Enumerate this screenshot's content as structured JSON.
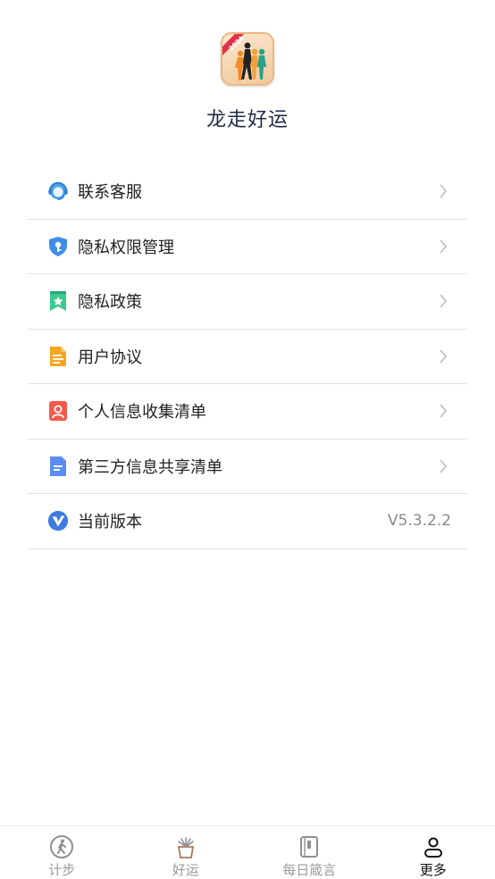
{
  "app": {
    "name": "龙走好运",
    "logo_badge": "2024"
  },
  "menu": {
    "items": [
      {
        "label": "联系客服",
        "icon": "customer-service-icon"
      },
      {
        "label": "隐私权限管理",
        "icon": "shield-key-icon"
      },
      {
        "label": "隐私政策",
        "icon": "bookmark-star-icon"
      },
      {
        "label": "用户协议",
        "icon": "document-icon"
      },
      {
        "label": "个人信息收集清单",
        "icon": "person-card-icon"
      },
      {
        "label": "第三方信息共享清单",
        "icon": "file-lines-icon"
      },
      {
        "label": "当前版本",
        "icon": "v-logo-icon",
        "value": "V5.3.2.2"
      }
    ]
  },
  "tabs": [
    {
      "label": "计步",
      "icon": "walking-icon",
      "active": false
    },
    {
      "label": "好运",
      "icon": "plant-pot-icon",
      "active": false
    },
    {
      "label": "每日箴言",
      "icon": "notebook-icon",
      "active": false
    },
    {
      "label": "更多",
      "icon": "user-icon",
      "active": true
    }
  ],
  "colors": {
    "text": "#222222",
    "muted": "#9a9a9a",
    "divider": "#e3e3e3",
    "title": "#1f2a44"
  }
}
